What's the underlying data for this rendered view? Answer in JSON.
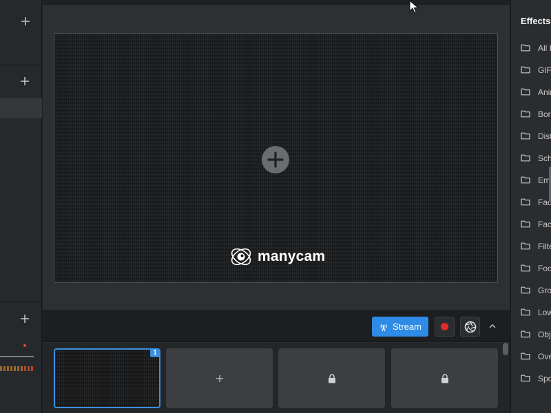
{
  "left_panel": {
    "add_icon": "plus-icon"
  },
  "preview": {
    "brand_text": "manycam",
    "add_icon": "plus-circle-icon"
  },
  "controls": {
    "stream_label": "Stream",
    "stream_icon": "broadcast-icon",
    "record_icon": "record-icon",
    "snapshot_icon": "camera-shutter-icon",
    "expand_icon": "chevron-up-icon"
  },
  "scenes": [
    {
      "type": "active",
      "badge": "1"
    },
    {
      "type": "add",
      "icon": "plus-icon"
    },
    {
      "type": "locked",
      "icon": "lock-icon"
    },
    {
      "type": "locked",
      "icon": "lock-icon"
    }
  ],
  "effects": {
    "title": "Effects",
    "items": [
      {
        "label": "All E"
      },
      {
        "label": "GIFS"
      },
      {
        "label": "Anin"
      },
      {
        "label": "Bord"
      },
      {
        "label": "Dist"
      },
      {
        "label": "Sch"
      },
      {
        "label": "Emc"
      },
      {
        "label": "Face"
      },
      {
        "label": "Face"
      },
      {
        "label": "Filte"
      },
      {
        "label": "Foo"
      },
      {
        "label": "Gro"
      },
      {
        "label": "Low"
      },
      {
        "label": "Obje"
      },
      {
        "label": "Ove"
      },
      {
        "label": "Spo"
      }
    ]
  },
  "colors": {
    "accent": "#2f8be6",
    "record": "#e02b2b",
    "active_scene_border": "#3b8fe0"
  }
}
